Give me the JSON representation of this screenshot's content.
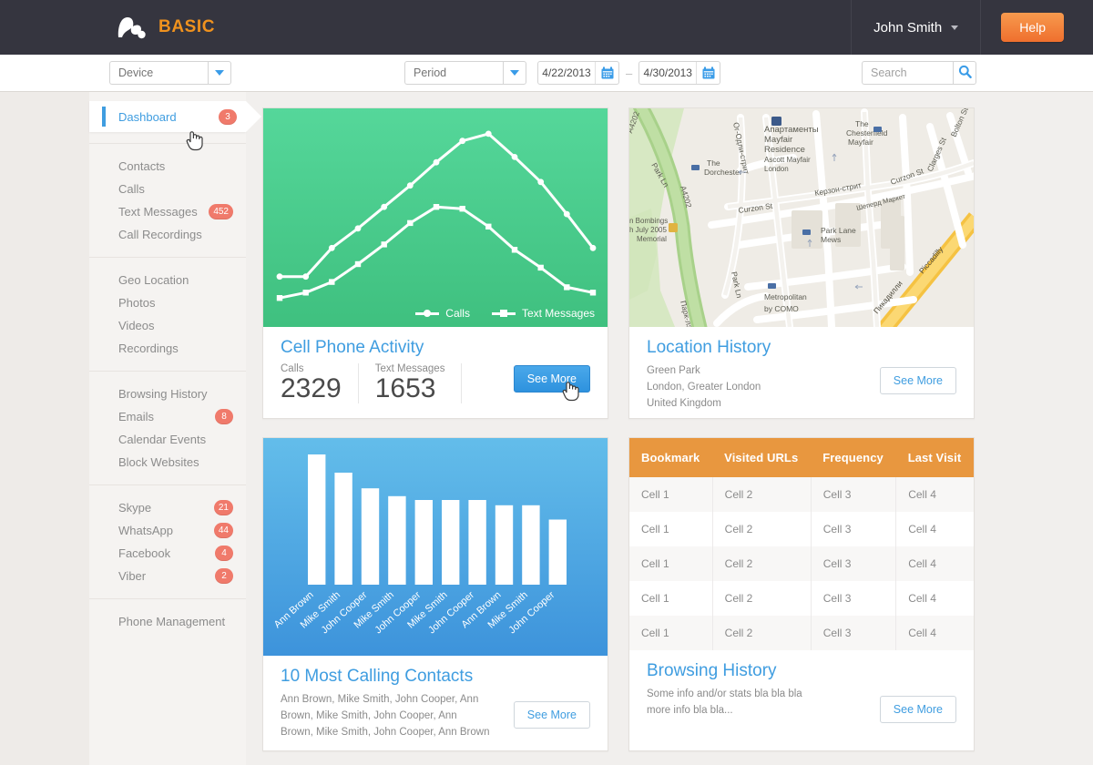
{
  "header": {
    "brand_text": "BASIC",
    "logo_icon": "logo-mark-icon",
    "user_name": "John Smith",
    "help_label": "Help"
  },
  "filterbar": {
    "device_placeholder": "Device",
    "period_placeholder": "Period",
    "date_from": "4/22/2013",
    "date_to": "4/30/2013",
    "date_separator": "–",
    "search_placeholder": "Search",
    "calendar_icon": "calendar-icon",
    "search_icon": "search-icon",
    "dropdown_icon": "chevron-down-icon"
  },
  "sidebar": {
    "groups": [
      {
        "items": [
          {
            "label": "Dashboard",
            "badge": "3",
            "active": true
          }
        ]
      },
      {
        "items": [
          {
            "label": "Contacts",
            "badge": ""
          },
          {
            "label": "Calls",
            "badge": ""
          },
          {
            "label": "Text Messages",
            "badge": "452"
          },
          {
            "label": "Call Recordings",
            "badge": ""
          }
        ]
      },
      {
        "items": [
          {
            "label": "Geo Location",
            "badge": ""
          },
          {
            "label": "Photos",
            "badge": ""
          },
          {
            "label": "Videos",
            "badge": ""
          },
          {
            "label": "Recordings",
            "badge": ""
          }
        ]
      },
      {
        "items": [
          {
            "label": "Browsing History",
            "badge": ""
          },
          {
            "label": "Emails",
            "badge": "8"
          },
          {
            "label": "Calendar Events",
            "badge": ""
          },
          {
            "label": "Block Websites",
            "badge": ""
          }
        ]
      },
      {
        "items": [
          {
            "label": "Skype",
            "badge": "21"
          },
          {
            "label": "WhatsApp",
            "badge": "44"
          },
          {
            "label": "Facebook",
            "badge": "4"
          },
          {
            "label": "Viber",
            "badge": "2"
          }
        ]
      },
      {
        "items": [
          {
            "label": "Phone Management",
            "badge": ""
          }
        ]
      }
    ]
  },
  "cards": {
    "cell_phone_activity": {
      "title": "Cell Phone Activity",
      "metrics": [
        {
          "label": "Calls",
          "value": "2329"
        },
        {
          "label": "Text Messages",
          "value": "1653"
        }
      ],
      "see_more_label": "See More"
    },
    "location_history": {
      "title": "Location History",
      "lines": [
        "Green Park",
        "London, Greater London",
        "United Kingdom"
      ],
      "see_more_label": "See More"
    },
    "most_calling_contacts": {
      "title": "10 Most Calling Contacts",
      "summary": "Ann Brown, Mike Smith, John Cooper, Ann Brown, Mike Smith, John Cooper, Ann Brown, Mike Smith, John Cooper, Ann Brown",
      "see_more_label": "See More"
    },
    "browsing_history": {
      "title": "Browsing History",
      "summary": "Some info and/or stats bla bla bla more info bla bla...",
      "see_more_label": "See More",
      "table": {
        "columns": [
          "Bookmark",
          "Visited URLs",
          "Frequency",
          "Last Visit"
        ],
        "rows": [
          [
            "Cell 1",
            "Cell 2",
            "Cell 3",
            "Cell 4"
          ],
          [
            "Cell 1",
            "Cell 2",
            "Cell 3",
            "Cell 4"
          ],
          [
            "Cell 1",
            "Cell 2",
            "Cell 3",
            "Cell 4"
          ],
          [
            "Cell 1",
            "Cell 2",
            "Cell 3",
            "Cell 4"
          ],
          [
            "Cell 1",
            "Cell 2",
            "Cell 3",
            "Cell 4"
          ]
        ]
      }
    }
  },
  "chart_data": [
    {
      "type": "line",
      "title": "Cell Phone Activity",
      "xlabel": "",
      "ylabel": "",
      "grid": false,
      "legend_position": "bottom-right",
      "x": [
        1,
        2,
        3,
        4,
        5,
        6,
        7,
        8,
        9,
        10,
        11,
        12,
        13
      ],
      "ylim": [
        0,
        100
      ],
      "series": [
        {
          "name": "Calls",
          "marker": "circle",
          "values": [
            17,
            17,
            33,
            44,
            56,
            68,
            81,
            93,
            97,
            84,
            70,
            52,
            33
          ]
        },
        {
          "name": "Text Messages",
          "marker": "square",
          "values": [
            5,
            8,
            14,
            24,
            35,
            47,
            56,
            55,
            45,
            32,
            22,
            11,
            8
          ]
        }
      ]
    },
    {
      "type": "bar",
      "title": "10 Most Calling Contacts",
      "xlabel": "",
      "ylabel": "",
      "grid": false,
      "ylim": [
        0,
        100
      ],
      "categories": [
        "Ann Brown",
        "Mike Smith",
        "John Cooper",
        "Mike Smith",
        "John Cooper",
        "Mike Smith",
        "John Cooper",
        "Ann Brown",
        "Mike Smith",
        "John Cooper"
      ],
      "values": [
        100,
        86,
        74,
        68,
        65,
        65,
        65,
        61,
        61,
        50
      ]
    }
  ],
  "map": {
    "labels": [
      "A4202",
      "Park Ln",
      "A4202",
      "Парк-лэйн",
      "Ог-Одли-стрит",
      "Апартаменты",
      "Mayfair",
      "Residence",
      "Ascott Mayfair",
      "London",
      "The",
      "Dorchester",
      "The",
      "Chesterfield",
      "Mayfair",
      "Curzon St",
      "Керзон-стрит",
      "Curzon St",
      "Clarges St",
      "Bolton St",
      "Шеперд Маркет",
      "Park Lane",
      "Mews",
      "Metropolitan",
      "by COMO",
      "Piccadilly",
      "Пикадилли",
      "n Bombings",
      "h July 2005",
      "Memorial",
      "Park Ln"
    ]
  },
  "colors": {
    "topbar": "#35353f",
    "brand_orange": "#f0921e",
    "accent_blue": "#3f9de0",
    "badge_red": "#f07a6b",
    "table_header_orange": "#e8973f",
    "chart_green_top": "#55d79a",
    "chart_green_bottom": "#3fc07f",
    "chart_blue_top": "#63bdea",
    "chart_blue_bottom": "#3d93db",
    "page_bg": "#f1efed"
  }
}
